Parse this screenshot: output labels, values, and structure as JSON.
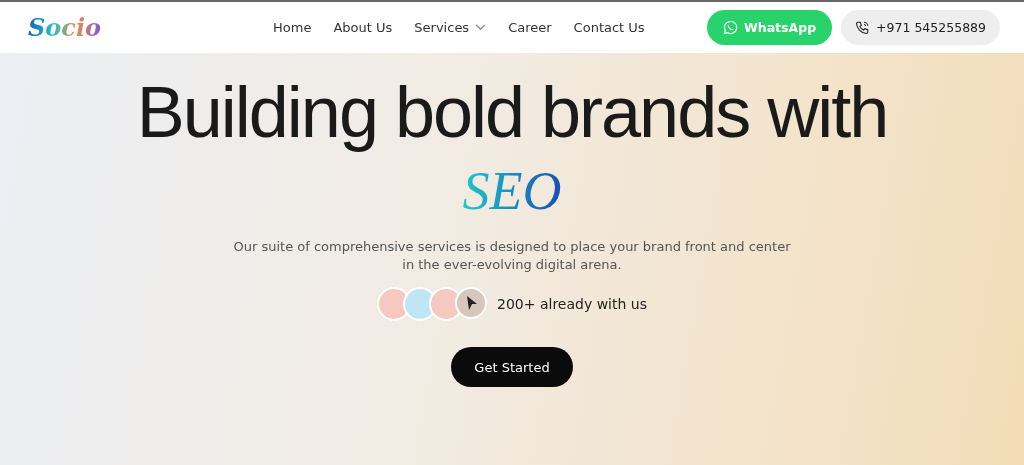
{
  "header": {
    "logo": "Socio",
    "nav": [
      {
        "label": "Home",
        "dropdown": false
      },
      {
        "label": "About Us",
        "dropdown": false
      },
      {
        "label": "Services",
        "dropdown": true
      },
      {
        "label": "Career",
        "dropdown": false
      },
      {
        "label": "Contact Us",
        "dropdown": false
      }
    ],
    "whatsapp_button": "WhatsApp",
    "phone_button": "+971 545255889"
  },
  "hero": {
    "title": "Building bold brands with",
    "highlight": "SEO",
    "description": "Our suite of comprehensive services is designed to place your brand front and center in the ever-evolving digital arena.",
    "avatars": [
      {
        "color": "#f6c9c0"
      },
      {
        "color": "#bfe6f5"
      },
      {
        "color": "#f6c9c0"
      }
    ],
    "social_proof": "200+ already with us",
    "cta": "Get Started"
  }
}
